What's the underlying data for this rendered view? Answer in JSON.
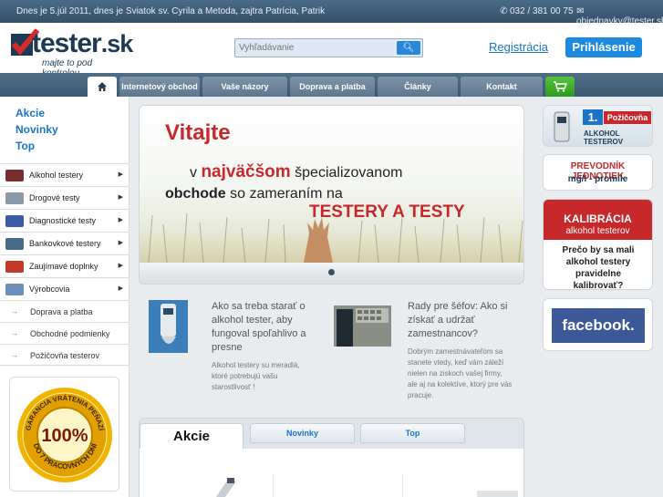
{
  "topbar": {
    "date_text": "Dnes je 5.júl 2011, dnes je Sviatok sv. Cyrila a Metoda, zajtra Patrícia, Patrik",
    "phone": "032 / 381 00 75",
    "email": "objednavky@tester.sk"
  },
  "header": {
    "logo_brand": "tester",
    "logo_tld": ".sk",
    "logo_tagline": "majte to pod kontrolou",
    "search_placeholder": "Vyhľadávanie",
    "register_label": "Registrácia",
    "login_label": "Prihlásenie"
  },
  "nav": {
    "tabs": [
      "Internetový obchod",
      "Vaše názory",
      "Doprava a platba",
      "Články",
      "Kontakt"
    ]
  },
  "sidebar": {
    "quick_links": [
      "Akcie",
      "Novinky",
      "Top"
    ],
    "categories": [
      {
        "label": "Alkohol testery",
        "color": "#7a2d2d"
      },
      {
        "label": "Drogové testy",
        "color": "#8a9aa8"
      },
      {
        "label": "Diagnostické testy",
        "color": "#3d5ea6"
      },
      {
        "label": "Bankovkové testery",
        "color": "#4b6a8a"
      },
      {
        "label": "Zaujímavé doplnky",
        "color": "#c23b2a"
      },
      {
        "label": "Výrobcovia",
        "color": "#6b8fb8"
      }
    ],
    "links": [
      "Doprava a platba",
      "Obchodné podmienky",
      "Požičovňa testerov"
    ],
    "guarantee_badge": {
      "line1": "GARANCIA VRÁTENIA PEŇAZÍ",
      "percent": "100%",
      "line2": "DO 7 PRACOVNÝCH DNÍ"
    }
  },
  "banner": {
    "line1": "Vitajte",
    "line2_pre": "v",
    "line2_bold": "najväčšom",
    "line2_post": "špecializovanom",
    "line3_bold": "obchode",
    "line3_post": "so zameraním na",
    "line4": "TESTERY A TESTY"
  },
  "articles": [
    {
      "title": "Ako sa treba starať o alkohol tester, aby fungoval spoľahlivo a presne",
      "text": "Alkohol testery su meradlá, ktoré potrebujú vašu starostlivosť !"
    },
    {
      "title": "Rady pre šéfov: Ako si získať a udržať zamestnancov?",
      "text": "Dobrým zamestnávateľom sa stanete vtedy, keď vám záleží nielen na ziskoch vašej firmy, ale aj na kolektíve, ktorý pre vás pracuje."
    }
  ],
  "lower_tabs": [
    "Akcie",
    "Novinky",
    "Top"
  ],
  "right_ads": {
    "rental": {
      "badge": "1.",
      "title": "Požičovňa",
      "subtitle": "ALKOHOL TESTEROV"
    },
    "converter": {
      "title": "PREVODNÍK JEDNOTIEK",
      "subtitle": "mg/l - promile"
    },
    "calibration": {
      "title": "KALIBRÁCIA",
      "subtitle": "alkohol testerov",
      "body": "Prečo by sa mali alkohol testery pravidelne kalibrovať?"
    },
    "facebook": {
      "label": "facebook."
    }
  },
  "colors": {
    "accent_blue": "#1b74c5",
    "brand_red": "#c7282c",
    "nav_dark": "#3b5a74",
    "cart_green": "#3aa82a"
  }
}
